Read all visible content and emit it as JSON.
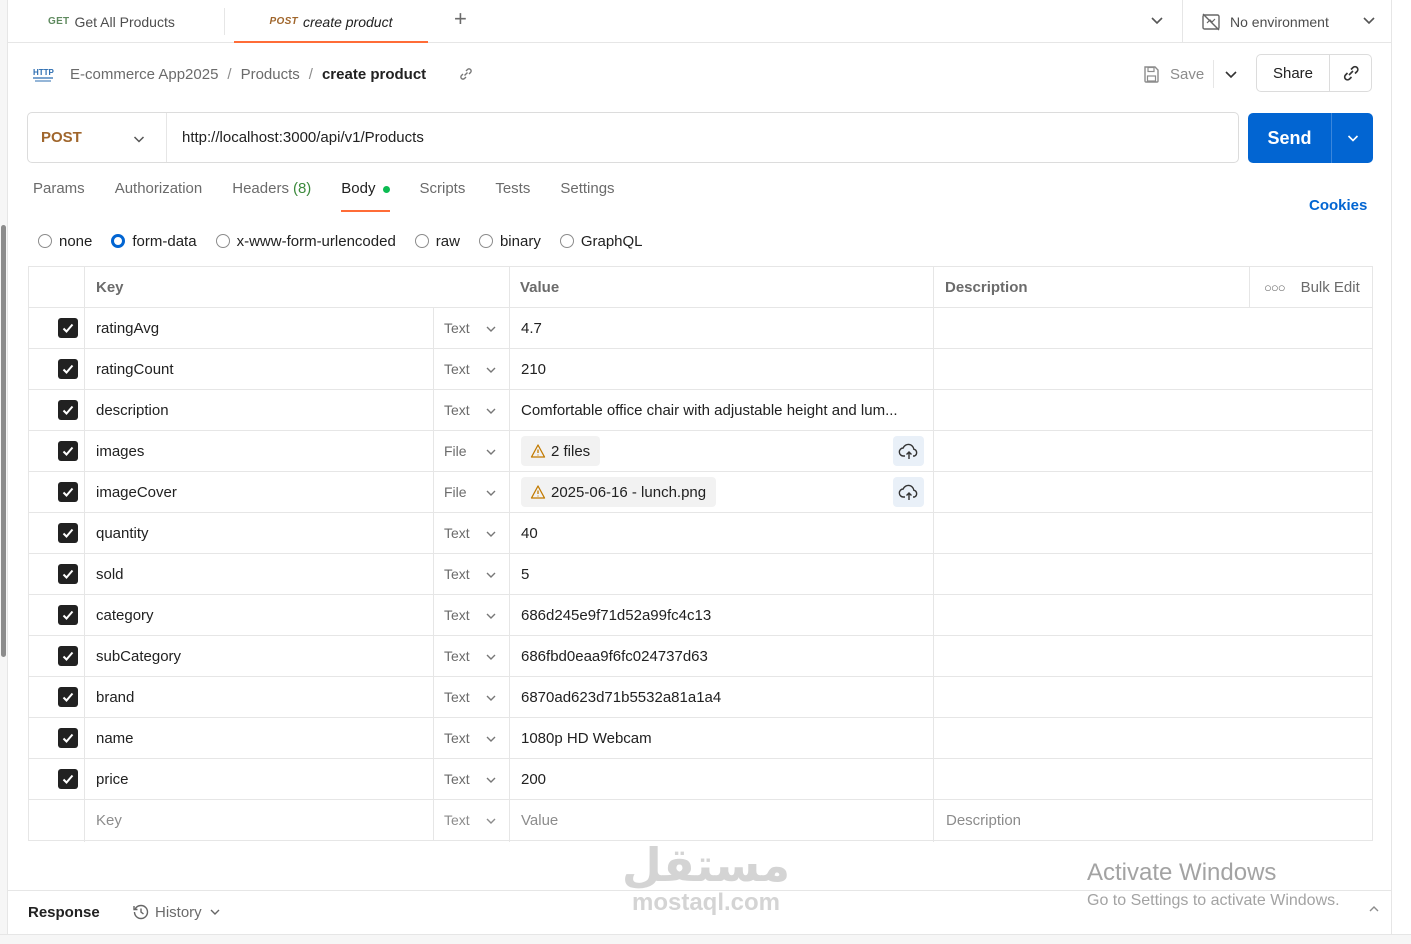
{
  "tabs": [
    {
      "method": "GET",
      "name": "Get All Products"
    },
    {
      "method": "POST",
      "name": "create product"
    }
  ],
  "environment": {
    "label": "No environment"
  },
  "breadcrumb": {
    "icon": "http-icon",
    "workspace": "E-commerce App2025",
    "folder": "Products",
    "current": "create product"
  },
  "toolbar": {
    "save_label": "Save",
    "share_label": "Share"
  },
  "request": {
    "method": "POST",
    "url": "http://localhost:3000/api/v1/Products",
    "send_label": "Send"
  },
  "request_tabs": [
    {
      "label": "Params"
    },
    {
      "label": "Authorization"
    },
    {
      "label": "Headers",
      "count": "(8)"
    },
    {
      "label": "Body"
    },
    {
      "label": "Scripts"
    },
    {
      "label": "Tests"
    },
    {
      "label": "Settings"
    }
  ],
  "cookies_label": "Cookies",
  "body_modes": [
    "none",
    "form-data",
    "x-www-form-urlencoded",
    "raw",
    "binary",
    "GraphQL"
  ],
  "body_mode_selected": "form-data",
  "table": {
    "headers": {
      "key": "Key",
      "value": "Value",
      "description": "Description",
      "bulk_edit": "Bulk Edit"
    },
    "rows": [
      {
        "key": "ratingAvg",
        "type": "Text",
        "value": "4.7"
      },
      {
        "key": "ratingCount",
        "type": "Text",
        "value": "210"
      },
      {
        "key": "description",
        "type": "Text",
        "value": "Comfortable office chair with adjustable height and lum..."
      },
      {
        "key": "images",
        "type": "File",
        "value": "2 files"
      },
      {
        "key": "imageCover",
        "type": "File",
        "value": "2025-06-16 - lunch.png"
      },
      {
        "key": "quantity",
        "type": "Text",
        "value": "40"
      },
      {
        "key": "sold",
        "type": "Text",
        "value": "5"
      },
      {
        "key": "category",
        "type": "Text",
        "value": "686d245e9f71d52a99fc4c13"
      },
      {
        "key": "subCategory",
        "type": "Text",
        "value": "686fbd0eaa9f6fc024737d63"
      },
      {
        "key": "brand",
        "type": "Text",
        "value": "6870ad623d71b5532a81a1a4"
      },
      {
        "key": "name",
        "type": "Text",
        "value": "1080p HD Webcam"
      },
      {
        "key": "price",
        "type": "Text",
        "value": "200"
      }
    ],
    "empty_row": {
      "key": "Key",
      "type": "Text",
      "value": "Value",
      "description": "Description"
    }
  },
  "response_bar": {
    "response_label": "Response",
    "history_label": "History"
  },
  "watermark": {
    "arabic": "مستقل",
    "latin": "mostaql.com"
  },
  "activation": {
    "title": "Activate Windows",
    "subtitle": "Go to Settings to activate Windows."
  },
  "colors": {
    "accent": "#ff6c37",
    "primary": "#0265d2",
    "post_method": "#a0662c",
    "get_method": "#5f8a5f",
    "active_dot": "#0cbb52"
  }
}
